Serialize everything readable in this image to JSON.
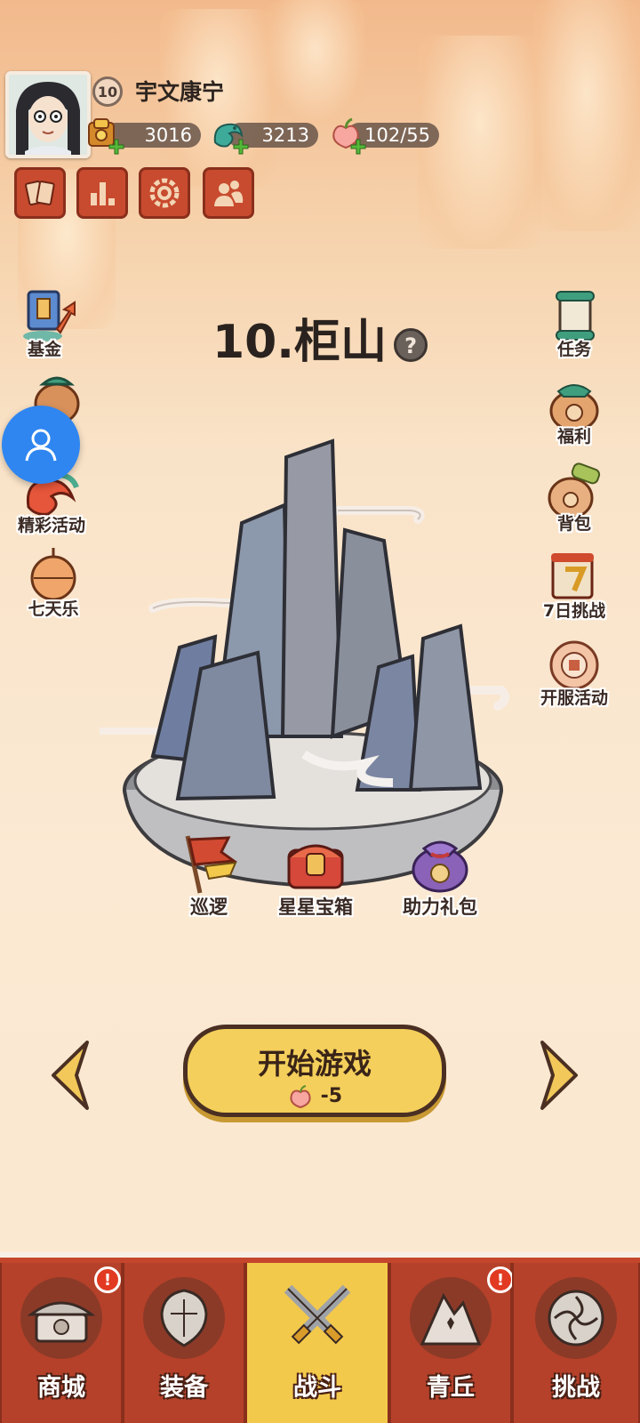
{
  "player": {
    "level": "10",
    "name": "宇文康宁"
  },
  "resources": [
    {
      "name": "coin",
      "icon": "coin-bundle-icon",
      "value": "3016"
    },
    {
      "name": "jade",
      "icon": "jade-dragon-icon",
      "value": "3213"
    },
    {
      "name": "stamina",
      "icon": "peach-icon",
      "value": "102/55"
    }
  ],
  "quick_buttons": [
    {
      "icon": "cards-icon"
    },
    {
      "icon": "ranking-icon"
    },
    {
      "icon": "settings-icon"
    },
    {
      "icon": "friends-icon"
    }
  ],
  "left_menu": [
    {
      "label": "基金",
      "icon": "fund-icon"
    },
    {
      "label": "",
      "icon": "gift-pouch-icon"
    },
    {
      "label": "精彩活动",
      "icon": "event-dragon-icon"
    },
    {
      "label": "七天乐",
      "icon": "lantern-icon"
    }
  ],
  "right_menu": [
    {
      "label": "任务",
      "icon": "scroll-icon"
    },
    {
      "label": "福利",
      "icon": "welfare-bag-icon"
    },
    {
      "label": "背包",
      "icon": "backpack-icon"
    },
    {
      "label": "7日挑战",
      "icon": "challenge-7day-icon"
    },
    {
      "label": "开服活动",
      "icon": "server-event-icon"
    }
  ],
  "stage": {
    "title": "10.柜山",
    "help": "?"
  },
  "stage_actions": [
    {
      "label": "巡逻",
      "icon": "patrol-flag-icon"
    },
    {
      "label": "星星宝箱",
      "icon": "star-chest-icon"
    },
    {
      "label": "助力礼包",
      "icon": "assist-giftbag-icon"
    }
  ],
  "start": {
    "label": "开始游戏",
    "cost": "-5"
  },
  "bottom_nav": [
    {
      "label": "商城",
      "icon": "shop-icon",
      "badge": "!"
    },
    {
      "label": "装备",
      "icon": "equipment-icon",
      "badge": ""
    },
    {
      "label": "战斗",
      "icon": "battle-swords-icon",
      "badge": "",
      "active": true
    },
    {
      "label": "青丘",
      "icon": "qingqiu-mountain-icon",
      "badge": "!"
    },
    {
      "label": "挑战",
      "icon": "challenge-icon",
      "badge": ""
    }
  ],
  "colors": {
    "accent_red": "#c4462c",
    "accent_yellow": "#f3c94c",
    "float_button_blue": "#2f86f0"
  }
}
